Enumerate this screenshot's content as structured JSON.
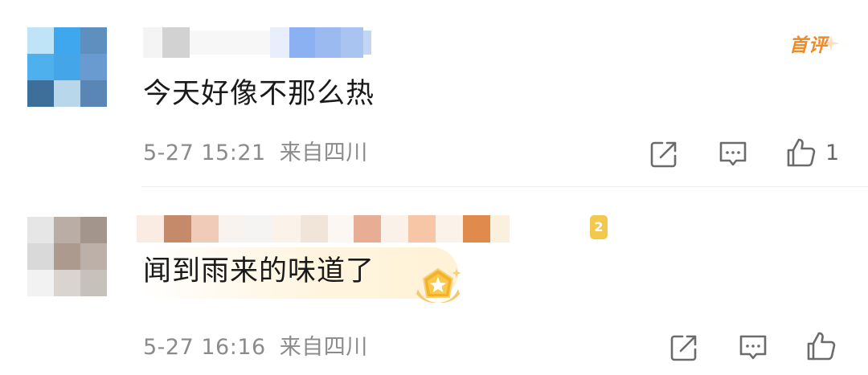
{
  "comments": [
    {
      "text": "今天好像不那么热",
      "time": "5-27 15:21",
      "location": "来自四川",
      "badge": "首评",
      "likes": "1",
      "icons": [
        "share-icon",
        "comment-icon",
        "like-icon"
      ]
    },
    {
      "text": "闻到雨来的味道了",
      "time": "5-27 16:16",
      "location": "来自四川",
      "level": "2",
      "likes": "",
      "icons": [
        "share-icon",
        "comment-icon",
        "like-icon"
      ]
    }
  ],
  "colors": {
    "text": "#1a1a1a",
    "meta": "#8b8b8b",
    "badge": "#f08a24"
  }
}
